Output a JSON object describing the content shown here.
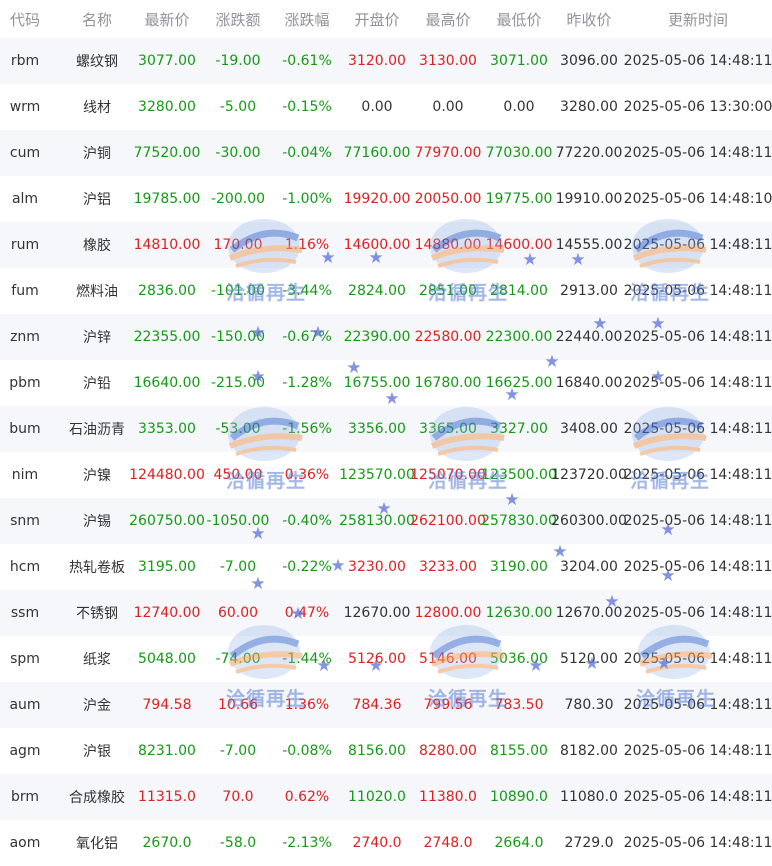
{
  "columns": [
    "代码",
    "名称",
    "最新价",
    "涨跌额",
    "涨跌幅",
    "开盘价",
    "最高价",
    "最低价",
    "昨收价",
    "更新时间"
  ],
  "rows": [
    {
      "code": "rbm",
      "name": "螺纹钢",
      "last": "3077.00",
      "change": "-19.00",
      "pct": "-0.61%",
      "open": "3120.00",
      "high": "3130.00",
      "low": "3071.00",
      "prev": "3096.00",
      "time": "2025-05-06 14:48:11",
      "colors": [
        "down",
        "down",
        "down",
        "up",
        "up",
        "down"
      ]
    },
    {
      "code": "wrm",
      "name": "线材",
      "last": "3280.00",
      "change": "-5.00",
      "pct": "-0.15%",
      "open": "0.00",
      "high": "0.00",
      "low": "0.00",
      "prev": "3280.00",
      "time": "2025-05-06 13:30:00",
      "colors": [
        "down",
        "down",
        "down",
        "flat",
        "flat",
        "flat"
      ]
    },
    {
      "code": "cum",
      "name": "沪铜",
      "last": "77520.00",
      "change": "-30.00",
      "pct": "-0.04%",
      "open": "77160.00",
      "high": "77970.00",
      "low": "77030.00",
      "prev": "77220.00",
      "time": "2025-05-06 14:48:11",
      "colors": [
        "down",
        "down",
        "down",
        "down",
        "up",
        "down"
      ]
    },
    {
      "code": "alm",
      "name": "沪铝",
      "last": "19785.00",
      "change": "-200.00",
      "pct": "-1.00%",
      "open": "19920.00",
      "high": "20050.00",
      "low": "19775.00",
      "prev": "19910.00",
      "time": "2025-05-06 14:48:10",
      "colors": [
        "down",
        "down",
        "down",
        "up",
        "up",
        "down"
      ]
    },
    {
      "code": "rum",
      "name": "橡胶",
      "last": "14810.00",
      "change": "170.00",
      "pct": "1.16%",
      "open": "14600.00",
      "high": "14880.00",
      "low": "14600.00",
      "prev": "14555.00",
      "time": "2025-05-06 14:48:11",
      "colors": [
        "up",
        "up",
        "up",
        "up",
        "up",
        "up"
      ]
    },
    {
      "code": "fum",
      "name": "燃料油",
      "last": "2836.00",
      "change": "-101.00",
      "pct": "-3.44%",
      "open": "2824.00",
      "high": "2851.00",
      "low": "2814.00",
      "prev": "2913.00",
      "time": "2025-05-06 14:48:11",
      "colors": [
        "down",
        "down",
        "down",
        "down",
        "down",
        "down"
      ]
    },
    {
      "code": "znm",
      "name": "沪锌",
      "last": "22355.00",
      "change": "-150.00",
      "pct": "-0.67%",
      "open": "22390.00",
      "high": "22580.00",
      "low": "22300.00",
      "prev": "22440.00",
      "time": "2025-05-06 14:48:11",
      "colors": [
        "down",
        "down",
        "down",
        "down",
        "up",
        "down"
      ]
    },
    {
      "code": "pbm",
      "name": "沪铅",
      "last": "16640.00",
      "change": "-215.00",
      "pct": "-1.28%",
      "open": "16755.00",
      "high": "16780.00",
      "low": "16625.00",
      "prev": "16840.00",
      "time": "2025-05-06 14:48:11",
      "colors": [
        "down",
        "down",
        "down",
        "down",
        "down",
        "down"
      ]
    },
    {
      "code": "bum",
      "name": "石油沥青",
      "last": "3353.00",
      "change": "-53.00",
      "pct": "-1.56%",
      "open": "3356.00",
      "high": "3365.00",
      "low": "3327.00",
      "prev": "3408.00",
      "time": "2025-05-06 14:48:11",
      "colors": [
        "down",
        "down",
        "down",
        "down",
        "down",
        "down"
      ]
    },
    {
      "code": "nim",
      "name": "沪镍",
      "last": "124480.00",
      "change": "450.00",
      "pct": "0.36%",
      "open": "123570.00",
      "high": "125070.00",
      "low": "123500.00",
      "prev": "123720.00",
      "time": "2025-05-06 14:48:11",
      "colors": [
        "up",
        "up",
        "up",
        "down",
        "up",
        "down"
      ]
    },
    {
      "code": "snm",
      "name": "沪锡",
      "last": "260750.00",
      "change": "-1050.00",
      "pct": "-0.40%",
      "open": "258130.00",
      "high": "262100.00",
      "low": "257830.00",
      "prev": "260300.00",
      "time": "2025-05-06 14:48:11",
      "colors": [
        "down",
        "down",
        "down",
        "down",
        "up",
        "down"
      ]
    },
    {
      "code": "hcm",
      "name": "热轧卷板",
      "last": "3195.00",
      "change": "-7.00",
      "pct": "-0.22%",
      "open": "3230.00",
      "high": "3233.00",
      "low": "3190.00",
      "prev": "3204.00",
      "time": "2025-05-06 14:48:11",
      "colors": [
        "down",
        "down",
        "down",
        "up",
        "up",
        "down"
      ]
    },
    {
      "code": "ssm",
      "name": "不锈钢",
      "last": "12740.00",
      "change": "60.00",
      "pct": "0.47%",
      "open": "12670.00",
      "high": "12800.00",
      "low": "12630.00",
      "prev": "12670.00",
      "time": "2025-05-06 14:48:11",
      "colors": [
        "up",
        "up",
        "up",
        "flat",
        "up",
        "down"
      ]
    },
    {
      "code": "spm",
      "name": "纸浆",
      "last": "5048.00",
      "change": "-74.00",
      "pct": "-1.44%",
      "open": "5126.00",
      "high": "5146.00",
      "low": "5036.00",
      "prev": "5120.00",
      "time": "2025-05-06 14:48:11",
      "colors": [
        "down",
        "down",
        "down",
        "up",
        "up",
        "down"
      ]
    },
    {
      "code": "aum",
      "name": "沪金",
      "last": "794.58",
      "change": "10.66",
      "pct": "1.36%",
      "open": "784.36",
      "high": "799.56",
      "low": "783.50",
      "prev": "780.30",
      "time": "2025-05-06 14:48:11",
      "colors": [
        "up",
        "up",
        "up",
        "up",
        "up",
        "up"
      ]
    },
    {
      "code": "agm",
      "name": "沪银",
      "last": "8231.00",
      "change": "-7.00",
      "pct": "-0.08%",
      "open": "8156.00",
      "high": "8280.00",
      "low": "8155.00",
      "prev": "8182.00",
      "time": "2025-05-06 14:48:11",
      "colors": [
        "down",
        "down",
        "down",
        "down",
        "up",
        "down"
      ]
    },
    {
      "code": "brm",
      "name": "合成橡胶",
      "last": "11315.0",
      "change": "70.0",
      "pct": "0.62%",
      "open": "11020.0",
      "high": "11380.0",
      "low": "10890.0",
      "prev": "11080.0",
      "time": "2025-05-06 14:48:11",
      "colors": [
        "up",
        "up",
        "up",
        "down",
        "up",
        "down"
      ]
    },
    {
      "code": "aom",
      "name": "氧化铝",
      "last": "2670.0",
      "change": "-58.0",
      "pct": "-2.13%",
      "open": "2740.0",
      "high": "2748.0",
      "low": "2664.0",
      "prev": "2729.0",
      "time": "2025-05-06 14:48:11",
      "colors": [
        "down",
        "down",
        "down",
        "up",
        "up",
        "down"
      ]
    }
  ],
  "watermark": {
    "text": "洽循再生",
    "icon": "recycle-logo-icon",
    "colors": [
      "#3f6fd0",
      "#f0a060",
      "#8fb0e8"
    ]
  },
  "theme": {
    "up": "#e02020",
    "down": "#159a15",
    "header_text": "#909399",
    "stripe": "#f5f7fa"
  }
}
